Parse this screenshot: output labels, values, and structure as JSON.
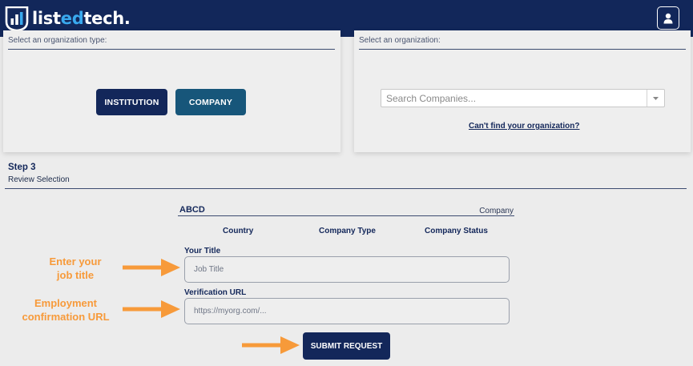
{
  "header": {
    "logo_prefix": "list",
    "logo_accent": "ed",
    "logo_suffix": "tech.",
    "user_icon": "user-icon",
    "colors": {
      "bar": "#12275a",
      "accent": "#39a9ee"
    }
  },
  "org_type_card": {
    "caption": "Select an organization type:",
    "institution_label": "INSTITUTION",
    "company_label": "COMPANY"
  },
  "org_card": {
    "caption": "Select an organization:",
    "search_placeholder": "Search Companies...",
    "dropdown_icon": "caret-down-icon",
    "cant_find_link": "Can't find your organization?"
  },
  "step3": {
    "title": "Step 3",
    "subtitle": "Review Selection",
    "org_name": "ABCD",
    "org_type": "Company",
    "columns": [
      "Country",
      "Company Type",
      "Company Status"
    ],
    "title_label": "Your Title",
    "title_placeholder": "Job Title",
    "url_label": "Verification URL",
    "url_placeholder": "https://myorg.com/...",
    "submit_label": "SUBMIT REQUEST"
  },
  "annotations": {
    "job_title_line1": "Enter your",
    "job_title_line2": "job title",
    "url_line1": "Employment",
    "url_line2": "confirmation URL",
    "arrow_color": "#f79a3a"
  }
}
